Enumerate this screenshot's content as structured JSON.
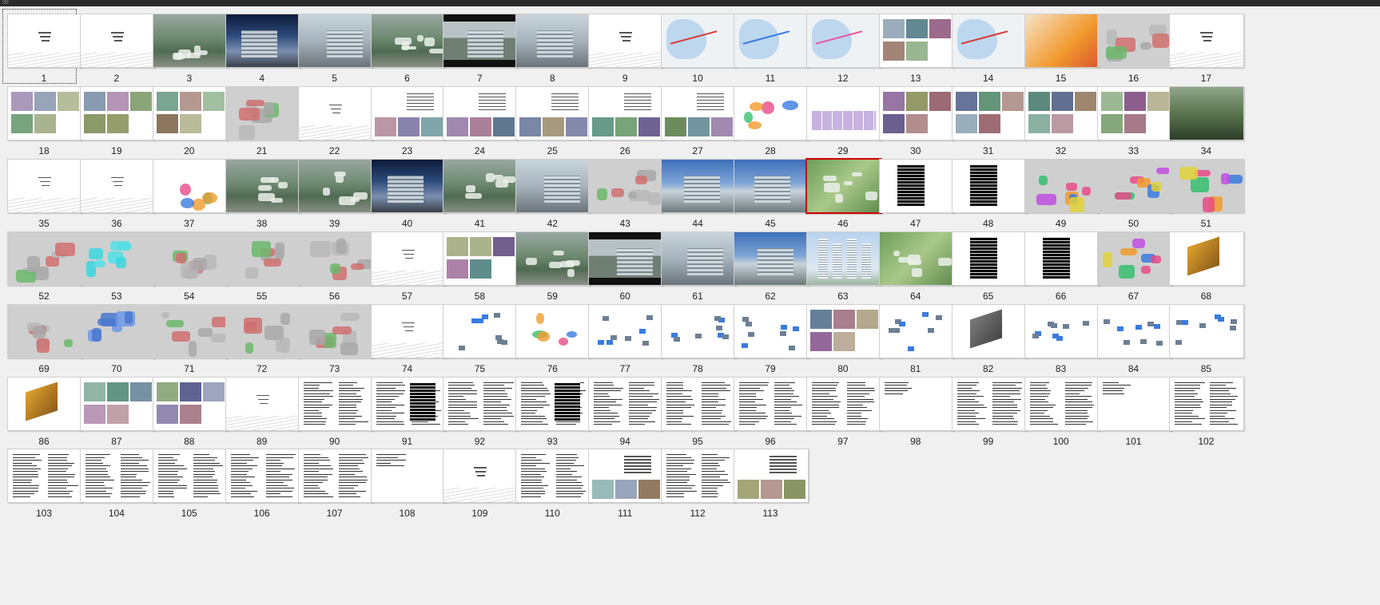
{
  "window": {
    "corner_glyph": "◎"
  },
  "selected_slide": 46,
  "focused_slide": 1,
  "slides": [
    {
      "n": "1",
      "kind": "title"
    },
    {
      "n": "2",
      "kind": "title"
    },
    {
      "n": "3",
      "kind": "aerial"
    },
    {
      "n": "4",
      "kind": "night"
    },
    {
      "n": "5",
      "kind": "building"
    },
    {
      "n": "6",
      "kind": "aerial"
    },
    {
      "n": "7",
      "kind": "dark-band"
    },
    {
      "n": "8",
      "kind": "building"
    },
    {
      "n": "9",
      "kind": "title"
    },
    {
      "n": "10",
      "kind": "map-red"
    },
    {
      "n": "11",
      "kind": "map-blue"
    },
    {
      "n": "12",
      "kind": "map-pink"
    },
    {
      "n": "13",
      "kind": "collage"
    },
    {
      "n": "14",
      "kind": "map-red"
    },
    {
      "n": "15",
      "kind": "heat"
    },
    {
      "n": "16",
      "kind": "map-gray"
    },
    {
      "n": "17",
      "kind": "title"
    },
    {
      "n": "18",
      "kind": "collage"
    },
    {
      "n": "19",
      "kind": "collage"
    },
    {
      "n": "20",
      "kind": "collage"
    },
    {
      "n": "21",
      "kind": "plan"
    },
    {
      "n": "22",
      "kind": "title"
    },
    {
      "n": "23",
      "kind": "text-photo"
    },
    {
      "n": "24",
      "kind": "text-photo"
    },
    {
      "n": "25",
      "kind": "text-photo"
    },
    {
      "n": "26",
      "kind": "text-photo"
    },
    {
      "n": "27",
      "kind": "text-photo"
    },
    {
      "n": "28",
      "kind": "diagram"
    },
    {
      "n": "29",
      "kind": "purple-table"
    },
    {
      "n": "30",
      "kind": "collage"
    },
    {
      "n": "31",
      "kind": "collage"
    },
    {
      "n": "32",
      "kind": "collage"
    },
    {
      "n": "33",
      "kind": "collage"
    },
    {
      "n": "34",
      "kind": "green-photo"
    },
    {
      "n": "35",
      "kind": "title"
    },
    {
      "n": "36",
      "kind": "title"
    },
    {
      "n": "37",
      "kind": "diagram"
    },
    {
      "n": "38",
      "kind": "aerial"
    },
    {
      "n": "39",
      "kind": "aerial"
    },
    {
      "n": "40",
      "kind": "night"
    },
    {
      "n": "41",
      "kind": "aerial"
    },
    {
      "n": "42",
      "kind": "building"
    },
    {
      "n": "43",
      "kind": "plan"
    },
    {
      "n": "44",
      "kind": "sky"
    },
    {
      "n": "45",
      "kind": "sky"
    },
    {
      "n": "46",
      "kind": "site-green"
    },
    {
      "n": "47",
      "kind": "black-table"
    },
    {
      "n": "48",
      "kind": "black-table"
    },
    {
      "n": "49",
      "kind": "color-map"
    },
    {
      "n": "50",
      "kind": "color-map"
    },
    {
      "n": "51",
      "kind": "color-map"
    },
    {
      "n": "52",
      "kind": "plan-gray"
    },
    {
      "n": "53",
      "kind": "plan-cyan"
    },
    {
      "n": "54",
      "kind": "plan-gray"
    },
    {
      "n": "55",
      "kind": "plan-gray"
    },
    {
      "n": "56",
      "kind": "plan-gray"
    },
    {
      "n": "57",
      "kind": "title"
    },
    {
      "n": "58",
      "kind": "collage"
    },
    {
      "n": "59",
      "kind": "aerial"
    },
    {
      "n": "60",
      "kind": "dark-band"
    },
    {
      "n": "61",
      "kind": "building"
    },
    {
      "n": "62",
      "kind": "sky"
    },
    {
      "n": "63",
      "kind": "towers"
    },
    {
      "n": "64",
      "kind": "site-green"
    },
    {
      "n": "65",
      "kind": "black-table"
    },
    {
      "n": "66",
      "kind": "black-table"
    },
    {
      "n": "67",
      "kind": "color-map"
    },
    {
      "n": "68",
      "kind": "iso"
    },
    {
      "n": "69",
      "kind": "plan-gray"
    },
    {
      "n": "70",
      "kind": "plan-blue"
    },
    {
      "n": "71",
      "kind": "plan-gray"
    },
    {
      "n": "72",
      "kind": "plan-gray"
    },
    {
      "n": "73",
      "kind": "plan-gray"
    },
    {
      "n": "74",
      "kind": "title"
    },
    {
      "n": "75",
      "kind": "schematic"
    },
    {
      "n": "76",
      "kind": "infographic"
    },
    {
      "n": "77",
      "kind": "schematic"
    },
    {
      "n": "78",
      "kind": "schematic"
    },
    {
      "n": "79",
      "kind": "schematic"
    },
    {
      "n": "80",
      "kind": "collage"
    },
    {
      "n": "81",
      "kind": "schematic"
    },
    {
      "n": "82",
      "kind": "section"
    },
    {
      "n": "83",
      "kind": "schematic"
    },
    {
      "n": "84",
      "kind": "schematic"
    },
    {
      "n": "85",
      "kind": "schematic"
    },
    {
      "n": "86",
      "kind": "iso"
    },
    {
      "n": "87",
      "kind": "collage"
    },
    {
      "n": "88",
      "kind": "collage"
    },
    {
      "n": "89",
      "kind": "title"
    },
    {
      "n": "90",
      "kind": "text"
    },
    {
      "n": "91",
      "kind": "text-black"
    },
    {
      "n": "92",
      "kind": "text"
    },
    {
      "n": "93",
      "kind": "text-black"
    },
    {
      "n": "94",
      "kind": "text"
    },
    {
      "n": "95",
      "kind": "text"
    },
    {
      "n": "96",
      "kind": "text"
    },
    {
      "n": "97",
      "kind": "text"
    },
    {
      "n": "98",
      "kind": "text-sparse"
    },
    {
      "n": "99",
      "kind": "text"
    },
    {
      "n": "100",
      "kind": "text"
    },
    {
      "n": "101",
      "kind": "text-sparse"
    },
    {
      "n": "102",
      "kind": "text"
    },
    {
      "n": "103",
      "kind": "text"
    },
    {
      "n": "104",
      "kind": "text"
    },
    {
      "n": "105",
      "kind": "text"
    },
    {
      "n": "106",
      "kind": "text"
    },
    {
      "n": "107",
      "kind": "text"
    },
    {
      "n": "108",
      "kind": "text-sparse"
    },
    {
      "n": "109",
      "kind": "title"
    },
    {
      "n": "110",
      "kind": "text"
    },
    {
      "n": "111",
      "kind": "text-photo"
    },
    {
      "n": "112",
      "kind": "text"
    },
    {
      "n": "113",
      "kind": "text-photo"
    }
  ],
  "palette": {
    "selection_border": "#d00000",
    "background": "#f0f0f0",
    "titlebar": "#2b2b2b"
  }
}
